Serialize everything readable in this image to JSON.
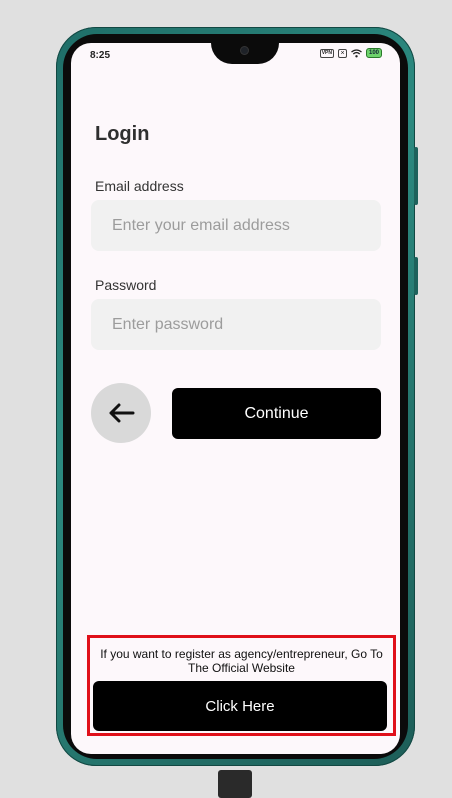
{
  "status_bar": {
    "time": "8:25",
    "vpn_label": "VPN",
    "battery_level": "100"
  },
  "login": {
    "title": "Login",
    "email_label": "Email address",
    "email_placeholder": "Enter your email address",
    "email_value": "",
    "password_label": "Password",
    "password_placeholder": "Enter password",
    "password_value": "",
    "continue_label": "Continue"
  },
  "register": {
    "text": "If you want to register as agency/entrepreneur, Go To The Official Website",
    "button_label": "Click Here"
  },
  "icons": {
    "back": "arrow-left-icon",
    "nav": [
      "recents-square-icon",
      "home-circle-icon",
      "back-triangle-icon"
    ]
  },
  "colors": {
    "accent_button": "#000000",
    "highlight_border": "#e0101a",
    "phone_frame": "#2c8a80"
  }
}
